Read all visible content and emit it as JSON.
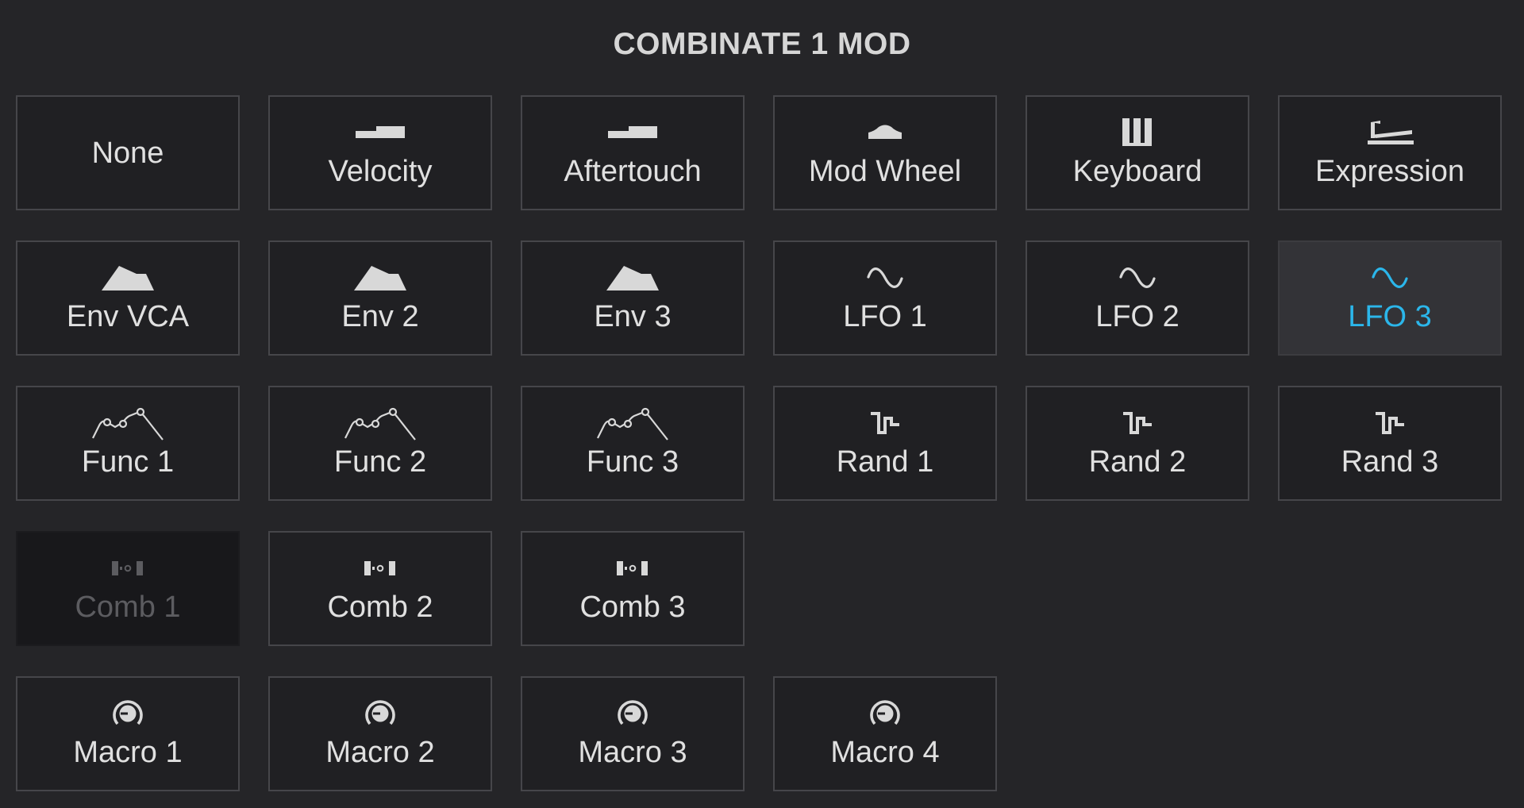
{
  "title": "COMBINATE 1 MOD",
  "accent_color": "#2bb6ea",
  "tiles": [
    {
      "label": "None",
      "icon": "",
      "state": "normal"
    },
    {
      "label": "Velocity",
      "icon": "velocity-icon",
      "state": "normal"
    },
    {
      "label": "Aftertouch",
      "icon": "aftertouch-icon",
      "state": "normal"
    },
    {
      "label": "Mod Wheel",
      "icon": "mod-wheel-icon",
      "state": "normal"
    },
    {
      "label": "Keyboard",
      "icon": "keyboard-icon",
      "state": "normal"
    },
    {
      "label": "Expression",
      "icon": "expression-pedal-icon",
      "state": "normal"
    },
    {
      "label": "Env VCA",
      "icon": "envelope-icon",
      "state": "normal"
    },
    {
      "label": "Env 2",
      "icon": "envelope-icon",
      "state": "normal"
    },
    {
      "label": "Env 3",
      "icon": "envelope-icon",
      "state": "normal"
    },
    {
      "label": "LFO 1",
      "icon": "sine-wave-icon",
      "state": "normal"
    },
    {
      "label": "LFO 2",
      "icon": "sine-wave-icon",
      "state": "normal"
    },
    {
      "label": "LFO 3",
      "icon": "sine-wave-icon",
      "state": "selected"
    },
    {
      "label": "Func 1",
      "icon": "function-curve-icon",
      "state": "normal"
    },
    {
      "label": "Func 2",
      "icon": "function-curve-icon",
      "state": "normal"
    },
    {
      "label": "Func 3",
      "icon": "function-curve-icon",
      "state": "normal"
    },
    {
      "label": "Rand 1",
      "icon": "random-step-icon",
      "state": "normal"
    },
    {
      "label": "Rand 2",
      "icon": "random-step-icon",
      "state": "normal"
    },
    {
      "label": "Rand 3",
      "icon": "random-step-icon",
      "state": "normal"
    },
    {
      "label": "Comb 1",
      "icon": "combinate-icon",
      "state": "disabled"
    },
    {
      "label": "Comb 2",
      "icon": "combinate-icon",
      "state": "normal"
    },
    {
      "label": "Comb 3",
      "icon": "combinate-icon",
      "state": "normal"
    },
    {
      "label": "Macro 1",
      "icon": "macro-knob-icon",
      "state": "normal",
      "break_after": true
    },
    {
      "label": "Macro 2",
      "icon": "macro-knob-icon",
      "state": "normal"
    },
    {
      "label": "Macro 3",
      "icon": "macro-knob-icon",
      "state": "normal"
    },
    {
      "label": "Macro 4",
      "icon": "macro-knob-icon",
      "state": "normal"
    }
  ]
}
